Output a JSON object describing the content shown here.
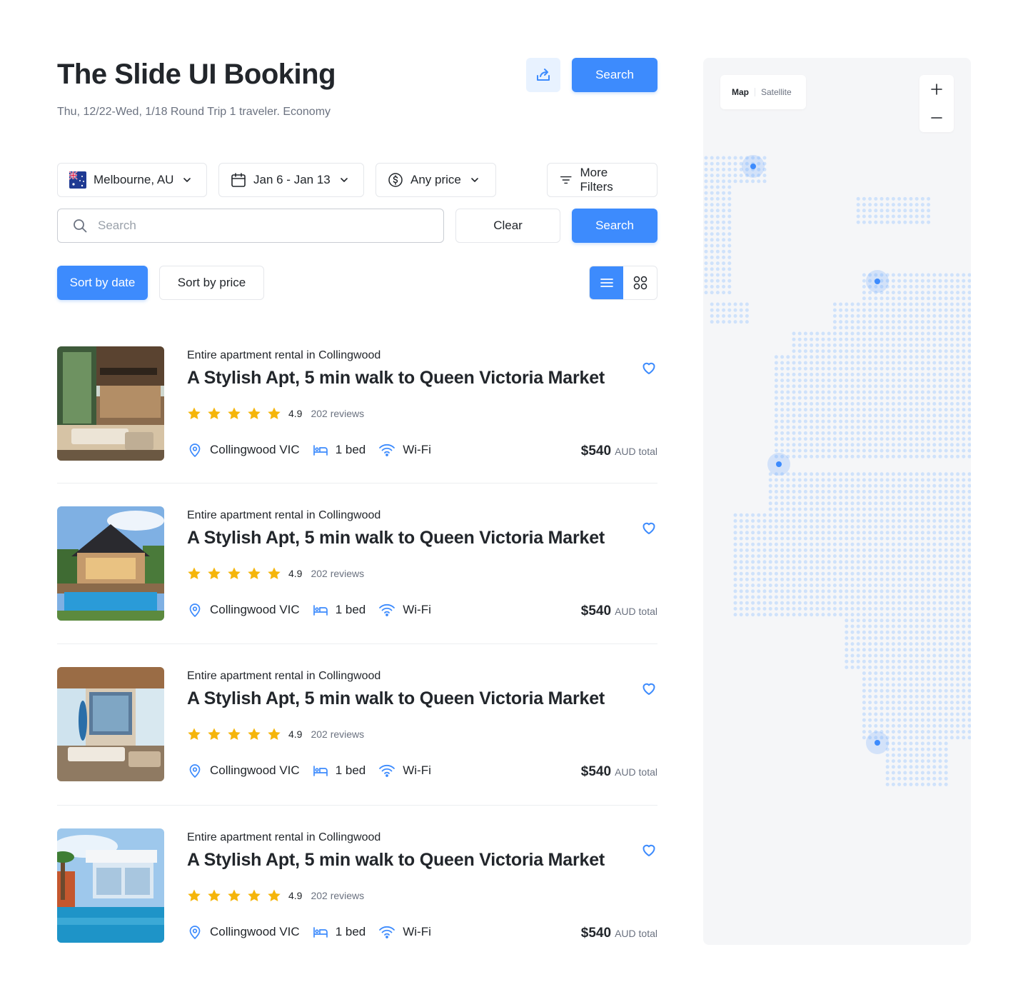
{
  "header": {
    "title": "The Slide UI Booking",
    "subtitle": "Thu, 12/22-Wed, 1/18 Round Trip 1 traveler. Economy",
    "share_icon": "share-icon",
    "search_label": "Search"
  },
  "filters": {
    "location": "Melbourne, AU",
    "dates": "Jan 6 - Jan 13",
    "price": "Any price",
    "more": "More Filters"
  },
  "search": {
    "placeholder": "Search",
    "value": "",
    "clear_label": "Clear",
    "search_label": "Search"
  },
  "sort": {
    "by_date": "Sort by date",
    "by_price": "Sort by price",
    "active": "date",
    "view_mode": "list"
  },
  "listings": [
    {
      "category": "Entire apartment rental in Collingwood",
      "title": "A Stylish Apt, 5 min walk to Queen Victoria Market",
      "rating": "4.9",
      "reviews": "202 reviews",
      "location": "Collingwood VIC",
      "beds": "1 bed",
      "amenity": "Wi-Fi",
      "price": "$540",
      "price_note": "AUD total",
      "stars": 5
    },
    {
      "category": "Entire apartment rental in Collingwood",
      "title": "A Stylish Apt, 5 min walk to Queen Victoria Market",
      "rating": "4.9",
      "reviews": "202 reviews",
      "location": "Collingwood VIC",
      "beds": "1 bed",
      "amenity": "Wi-Fi",
      "price": "$540",
      "price_note": "AUD total",
      "stars": 5
    },
    {
      "category": "Entire apartment rental in Collingwood",
      "title": "A Stylish Apt, 5 min walk to Queen Victoria Market",
      "rating": "4.9",
      "reviews": "202 reviews",
      "location": "Collingwood VIC",
      "beds": "1 bed",
      "amenity": "Wi-Fi",
      "price": "$540",
      "price_note": "AUD total",
      "stars": 5
    },
    {
      "category": "Entire apartment rental in Collingwood",
      "title": "A Stylish Apt, 5 min walk to Queen Victoria Market",
      "rating": "4.9",
      "reviews": "202 reviews",
      "location": "Collingwood VIC",
      "beds": "1 bed",
      "amenity": "Wi-Fi",
      "price": "$540",
      "price_note": "AUD total",
      "stars": 5
    }
  ],
  "map": {
    "tab_map": "Map",
    "tab_satellite": "Satellite",
    "active_tab": "Map",
    "zoom_in_icon": "plus-icon",
    "zoom_out_icon": "minus-icon"
  },
  "colors": {
    "accent": "#3d8bfd",
    "star": "#f5b50a",
    "text": "#22262b",
    "muted": "#6b7280",
    "map_dot": "#cfe2fb",
    "map_bg": "#f5f6f8"
  }
}
